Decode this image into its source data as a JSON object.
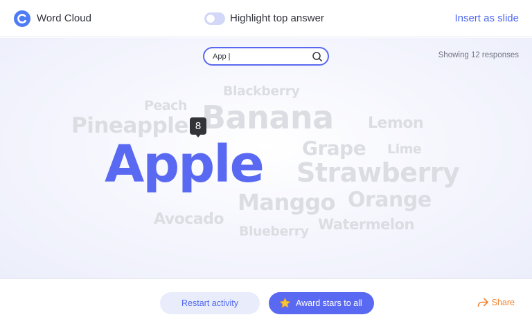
{
  "header": {
    "app_title": "Word Cloud",
    "highlight_toggle_label": "Highlight top answer",
    "highlight_toggle_on": false,
    "insert_label": "Insert as slide"
  },
  "search": {
    "value": "App |",
    "icon": "search-icon"
  },
  "summary": {
    "showing_label": "Showing 12 responses"
  },
  "word_cloud": {
    "words": [
      {
        "text": "Blackberry",
        "highlighted": false
      },
      {
        "text": "Peach",
        "highlighted": false
      },
      {
        "text": "Banana",
        "highlighted": false
      },
      {
        "text": "Pineapple",
        "highlighted": false
      },
      {
        "text": "Lemon",
        "highlighted": false
      },
      {
        "text": "Grape",
        "highlighted": false
      },
      {
        "text": "Lime",
        "highlighted": false
      },
      {
        "text": "Apple",
        "highlighted": true,
        "count": "8"
      },
      {
        "text": "Strawberry",
        "highlighted": false
      },
      {
        "text": "Manggo",
        "highlighted": false
      },
      {
        "text": "Orange",
        "highlighted": false
      },
      {
        "text": "Avocado",
        "highlighted": false
      },
      {
        "text": "Watermelon",
        "highlighted": false
      },
      {
        "text": "Blueberry",
        "highlighted": false
      }
    ],
    "highlight_color": "#5a69f2",
    "muted_color": "#dcdde2"
  },
  "footer": {
    "restart_label": "Restart activity",
    "award_label": "Award stars to all",
    "share_label": "Share"
  },
  "colors": {
    "accent": "#5a69f2",
    "link": "#4f67ef",
    "share": "#ef8232"
  }
}
